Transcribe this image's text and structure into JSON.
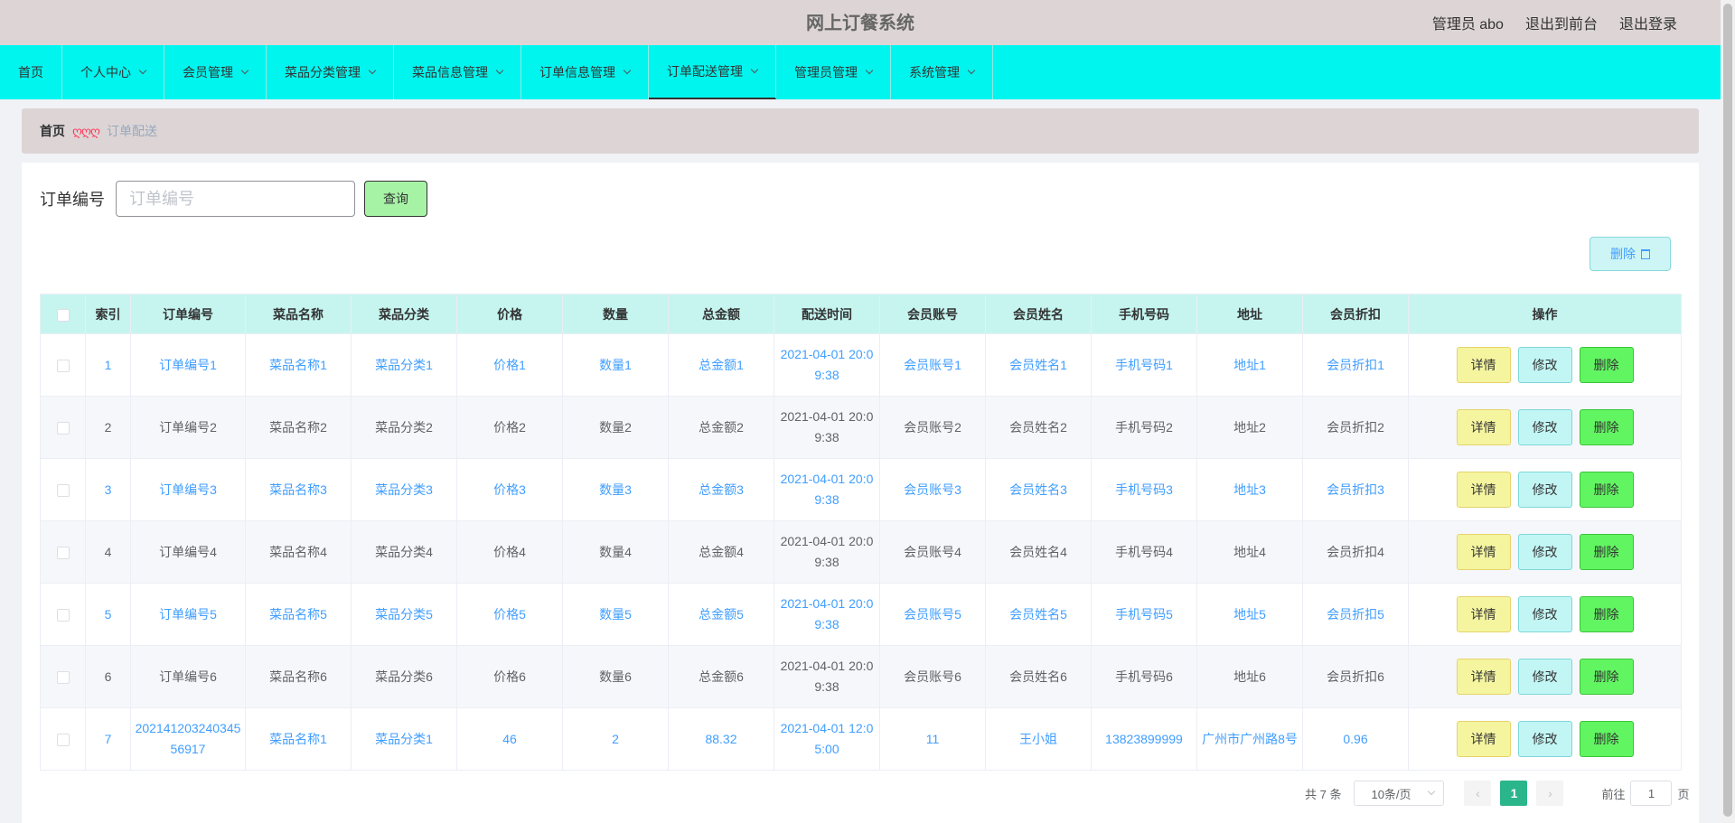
{
  "header": {
    "title": "网上订餐系统",
    "admin": "管理员 abo",
    "to_front": "退出到前台",
    "logout": "退出登录"
  },
  "nav": [
    {
      "label": "首页",
      "dropdown": false
    },
    {
      "label": "个人中心",
      "dropdown": true
    },
    {
      "label": "会员管理",
      "dropdown": true
    },
    {
      "label": "菜品分类管理",
      "dropdown": true
    },
    {
      "label": "菜品信息管理",
      "dropdown": true
    },
    {
      "label": "订单信息管理",
      "dropdown": true
    },
    {
      "label": "订单配送管理",
      "dropdown": true,
      "active": true
    },
    {
      "label": "管理员管理",
      "dropdown": true
    },
    {
      "label": "系统管理",
      "dropdown": true
    }
  ],
  "breadcrumb": {
    "home": "首页",
    "separator": "ღღღ",
    "current": "订单配送"
  },
  "search": {
    "label": "订单编号",
    "placeholder": "订单编号",
    "value": "",
    "button": "查询"
  },
  "toolbar": {
    "delete_label": "删除"
  },
  "table": {
    "columns": [
      "",
      "索引",
      "订单编号",
      "菜品名称",
      "菜品分类",
      "价格",
      "数量",
      "总金额",
      "配送时间",
      "会员账号",
      "会员姓名",
      "手机号码",
      "地址",
      "会员折扣",
      "操作"
    ],
    "rows": [
      {
        "index": "1",
        "order_no": "订单编号1",
        "dish_name": "菜品名称1",
        "dish_cat": "菜品分类1",
        "price": "价格1",
        "qty": "数量1",
        "total": "总金额1",
        "time": "2021-04-01 20:09:38",
        "account": "会员账号1",
        "member": "会员姓名1",
        "phone": "手机号码1",
        "address": "地址1",
        "discount": "会员折扣1"
      },
      {
        "index": "2",
        "order_no": "订单编号2",
        "dish_name": "菜品名称2",
        "dish_cat": "菜品分类2",
        "price": "价格2",
        "qty": "数量2",
        "total": "总金额2",
        "time": "2021-04-01 20:09:38",
        "account": "会员账号2",
        "member": "会员姓名2",
        "phone": "手机号码2",
        "address": "地址2",
        "discount": "会员折扣2"
      },
      {
        "index": "3",
        "order_no": "订单编号3",
        "dish_name": "菜品名称3",
        "dish_cat": "菜品分类3",
        "price": "价格3",
        "qty": "数量3",
        "total": "总金额3",
        "time": "2021-04-01 20:09:38",
        "account": "会员账号3",
        "member": "会员姓名3",
        "phone": "手机号码3",
        "address": "地址3",
        "discount": "会员折扣3"
      },
      {
        "index": "4",
        "order_no": "订单编号4",
        "dish_name": "菜品名称4",
        "dish_cat": "菜品分类4",
        "price": "价格4",
        "qty": "数量4",
        "total": "总金额4",
        "time": "2021-04-01 20:09:38",
        "account": "会员账号4",
        "member": "会员姓名4",
        "phone": "手机号码4",
        "address": "地址4",
        "discount": "会员折扣4"
      },
      {
        "index": "5",
        "order_no": "订单编号5",
        "dish_name": "菜品名称5",
        "dish_cat": "菜品分类5",
        "price": "价格5",
        "qty": "数量5",
        "total": "总金额5",
        "time": "2021-04-01 20:09:38",
        "account": "会员账号5",
        "member": "会员姓名5",
        "phone": "手机号码5",
        "address": "地址5",
        "discount": "会员折扣5"
      },
      {
        "index": "6",
        "order_no": "订单编号6",
        "dish_name": "菜品名称6",
        "dish_cat": "菜品分类6",
        "price": "价格6",
        "qty": "数量6",
        "total": "总金额6",
        "time": "2021-04-01 20:09:38",
        "account": "会员账号6",
        "member": "会员姓名6",
        "phone": "手机号码6",
        "address": "地址6",
        "discount": "会员折扣6"
      },
      {
        "index": "7",
        "order_no": "20214120324034556917",
        "dish_name": "菜品名称1",
        "dish_cat": "菜品分类1",
        "price": "46",
        "qty": "2",
        "total": "88.32",
        "time": "2021-04-01 12:05:00",
        "account": "11",
        "member": "王小姐",
        "phone": "13823899999",
        "address": "广州市广州路8号",
        "discount": "0.96"
      }
    ],
    "actions": {
      "detail": "详情",
      "edit": "修改",
      "delete": "删除"
    }
  },
  "pagination": {
    "total": "共 7 条",
    "page_size": "10条/页",
    "prev": "‹",
    "current": "1",
    "next": "›",
    "goto_prefix": "前往",
    "goto_value": "1",
    "goto_suffix": "页"
  }
}
